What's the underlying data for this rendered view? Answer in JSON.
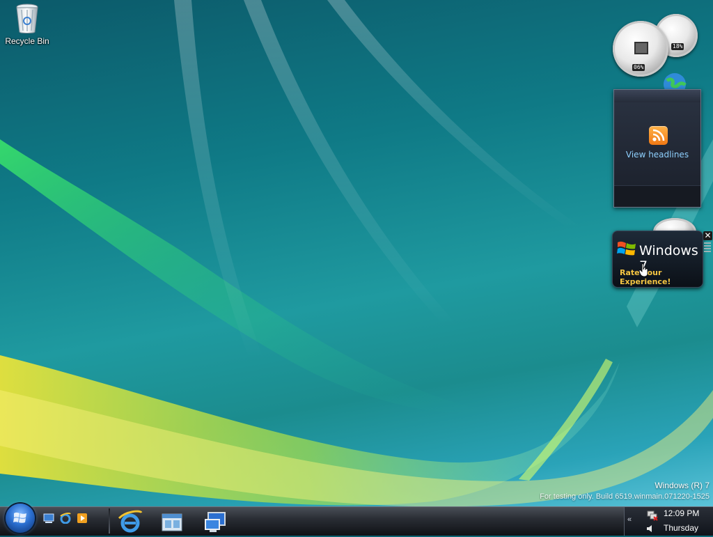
{
  "desktop": {
    "recycle_bin_label": "Recycle Bin"
  },
  "gadgets": {
    "cpu_meter": {
      "cpu_percent": "06%",
      "memory_percent": "18%"
    },
    "feed_headlines": {
      "link_label": "View headlines"
    },
    "feedback": {
      "title": "Windows 7",
      "action_label": "Rate your Experience!",
      "close_glyph": "✕"
    }
  },
  "watermark": {
    "line1": "Windows (R) 7",
    "line2": "For testing only. Build 6519.winmain.071220-1525"
  },
  "taskbar": {
    "quick_launch": [
      "show-desktop-icon",
      "internet-explorer-icon",
      "media-player-icon"
    ],
    "pinned": [
      "internet-explorer-icon",
      "windows-explorer-icon",
      "remote-desktop-icon"
    ],
    "tray": {
      "chevron": "«",
      "time": "12:09 PM",
      "day": "Thursday"
    }
  },
  "colors": {
    "accent_blue": "#2b6fd0",
    "rss_orange": "#f07814",
    "feedback_gold": "#f5c542"
  }
}
